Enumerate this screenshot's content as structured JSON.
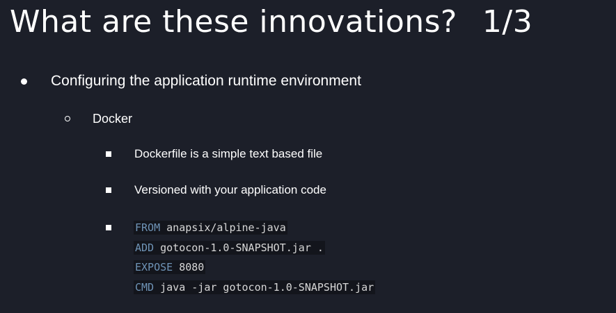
{
  "slide": {
    "title": "What are these innovations?",
    "counter": "1/3",
    "bullet_l1": "Configuring the application runtime environment",
    "bullet_l2": "Docker",
    "bullet_l3": [
      "Dockerfile is a simple text based file",
      "Versioned with your application code"
    ],
    "code_lines": [
      {
        "keyword": "FROM",
        "rest": " anapsix/alpine-java"
      },
      {
        "keyword": "ADD",
        "rest": " gotocon-1.0-SNAPSHOT.jar ."
      },
      {
        "keyword": "EXPOSE",
        "rest": " 8080"
      },
      {
        "keyword": "CMD",
        "rest": " java -jar gotocon-1.0-SNAPSHOT.jar"
      }
    ]
  },
  "colors": {
    "background": "#1c1f29",
    "text": "#ffffff",
    "code_keyword": "#6f94b7",
    "code_text": "#d7d7d7",
    "code_background": "#13151c"
  }
}
